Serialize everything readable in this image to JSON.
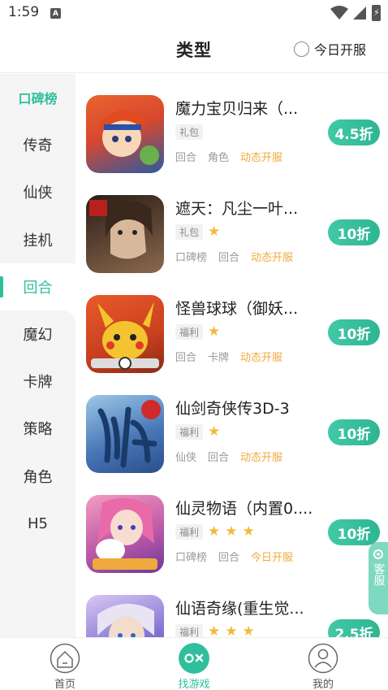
{
  "status": {
    "time": "1:59",
    "notif_letter": "A"
  },
  "header": {
    "title": "类型",
    "today_label": "今日开服"
  },
  "sidebar": {
    "items": [
      {
        "label": "口碑榜"
      },
      {
        "label": "传奇"
      },
      {
        "label": "仙侠"
      },
      {
        "label": "挂机"
      },
      {
        "label": "回合"
      },
      {
        "label": "魔幻"
      },
      {
        "label": "卡牌"
      },
      {
        "label": "策略"
      },
      {
        "label": "角色"
      },
      {
        "label": "H5"
      }
    ],
    "active_index": 4
  },
  "games": [
    {
      "name": "魔力宝贝归来（...",
      "tag": "礼包",
      "stars": 0,
      "meta": [
        "回合",
        "角色"
      ],
      "hot": "动态开服",
      "discount": "4.5折",
      "colors": [
        "#d9472f",
        "#2c5aa0"
      ]
    },
    {
      "name": "遮天：凡尘一叶...",
      "tag": "礼包",
      "stars": 1,
      "meta": [
        "口碑榜",
        "回合"
      ],
      "hot": "动态开服",
      "discount": "10折",
      "colors": [
        "#3a2a22",
        "#8a6a4c"
      ]
    },
    {
      "name": "怪兽球球（御妖...",
      "tag": "福利",
      "stars": 1,
      "meta": [
        "回合",
        "卡牌"
      ],
      "hot": "动态开服",
      "discount": "10折",
      "colors": [
        "#f4c430",
        "#c8401f"
      ]
    },
    {
      "name": "仙剑奇侠传3D-3",
      "tag": "福利",
      "stars": 1,
      "meta": [
        "仙侠",
        "回合"
      ],
      "hot": "动态开服",
      "discount": "10折",
      "colors": [
        "#2a4e8c",
        "#9cc8e8"
      ]
    },
    {
      "name": "仙灵物语（内置0....",
      "tag": "福利",
      "stars": 3,
      "meta": [
        "口碑榜",
        "回合"
      ],
      "hot": "今日开服",
      "discount": "10折",
      "colors": [
        "#c05aa8",
        "#f29cc0"
      ]
    },
    {
      "name": "仙语奇缘(重生觉...",
      "tag": "福利",
      "stars": 3,
      "meta": [],
      "hot": "",
      "discount": "2.5折",
      "colors": [
        "#6a5ac8",
        "#d8c8f0"
      ]
    }
  ],
  "customer_service": {
    "label": "客服"
  },
  "bottom_nav": {
    "items": [
      {
        "label": "首页"
      },
      {
        "label": "找游戏"
      },
      {
        "label": "我的"
      }
    ],
    "active_index": 1
  },
  "colors": {
    "accent": "#2fbf9c",
    "star": "#f4b93c",
    "hot": "#f0a93c"
  }
}
